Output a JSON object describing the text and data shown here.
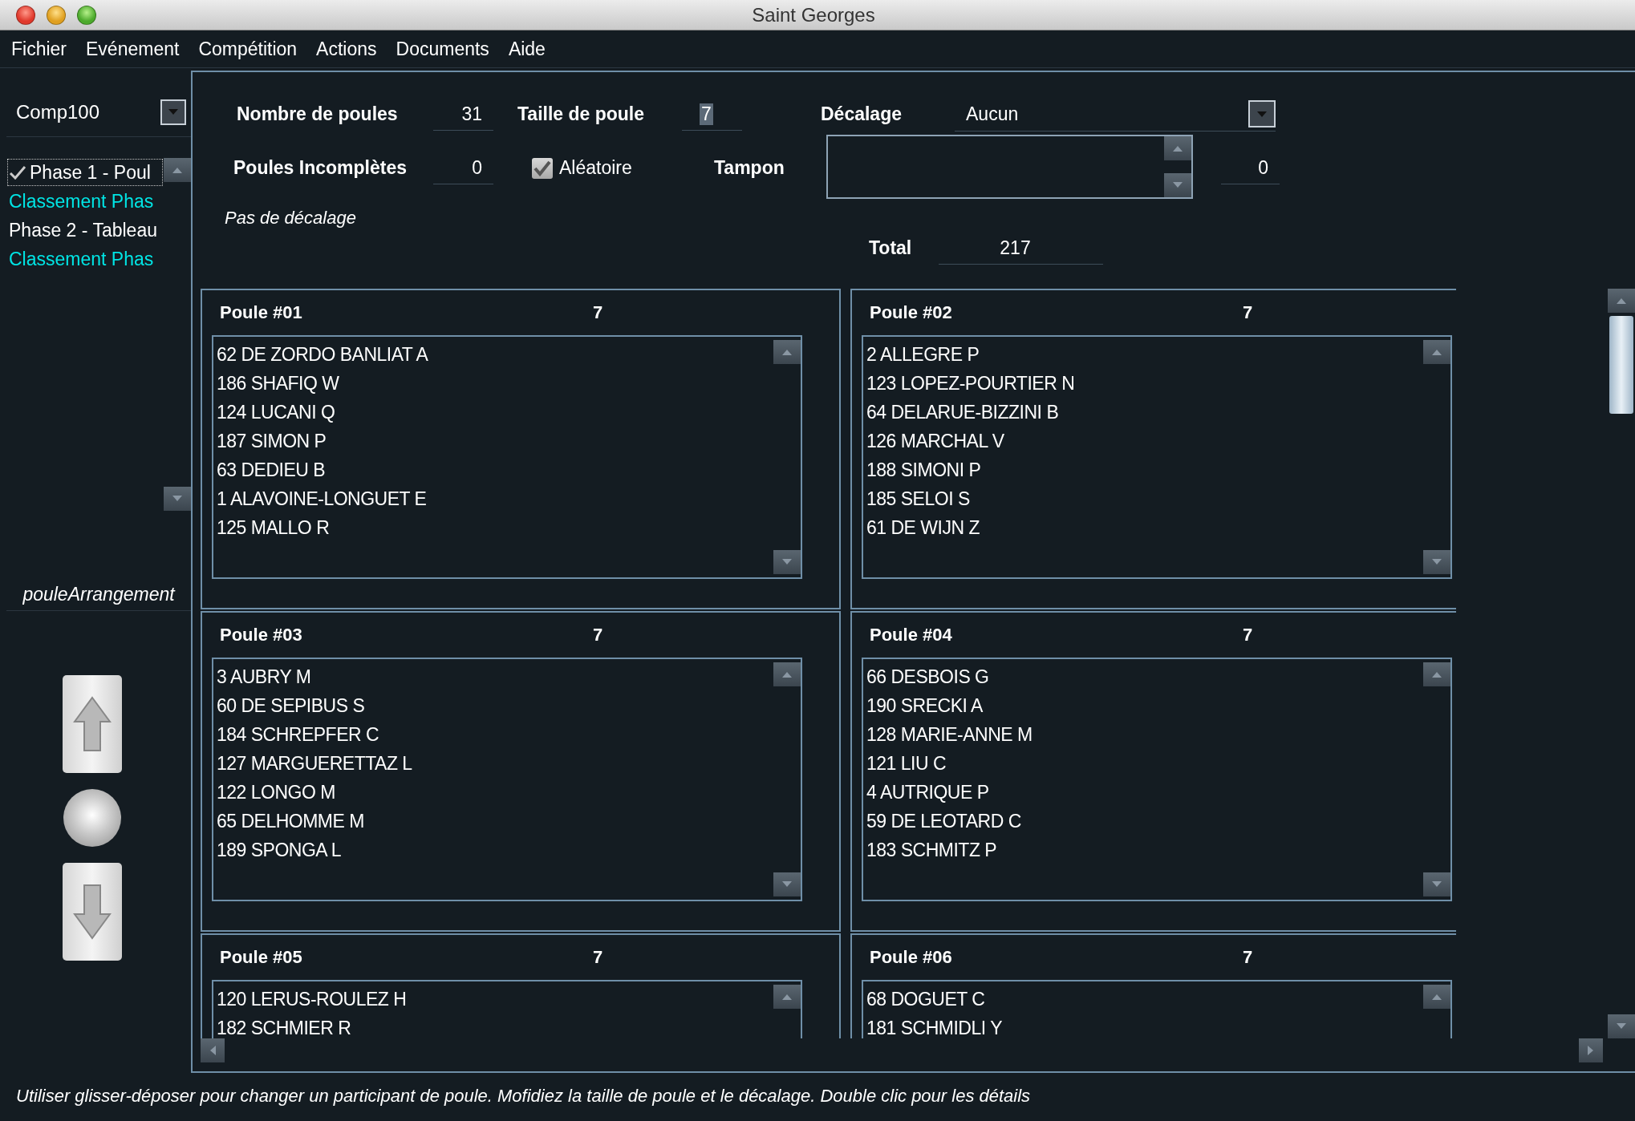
{
  "window": {
    "title": "Saint Georges"
  },
  "menu": [
    "Fichier",
    "Evénement",
    "Compétition",
    "Actions",
    "Documents",
    "Aide"
  ],
  "sidebar": {
    "competition": "Comp100",
    "phases": [
      {
        "label": "Phase 1 - Poul",
        "checked": true,
        "selected": true,
        "color": "#ffffff"
      },
      {
        "label": "Classement Phas",
        "checked": false,
        "selected": false,
        "color": "#00e5e5"
      },
      {
        "label": "Phase 2 - Tableau",
        "checked": false,
        "selected": false,
        "color": "#ffffff"
      },
      {
        "label": "Classement Phas",
        "checked": false,
        "selected": false,
        "color": "#00e5e5"
      }
    ],
    "section_label": "pouleArrangement"
  },
  "form": {
    "nombre_de_poules": {
      "label": "Nombre de poules",
      "value": "31"
    },
    "taille_de_poule": {
      "label": "Taille de poule",
      "value": "7"
    },
    "decalage": {
      "label": "Décalage",
      "value": "Aucun"
    },
    "poules_incompletes": {
      "label": "Poules Incomplètes",
      "value": "0"
    },
    "aleatoire": {
      "label": "Aléatoire",
      "checked": true
    },
    "tampon": {
      "label": "Tampon",
      "value": "0"
    },
    "note": "Pas de décalage",
    "total": {
      "label": "Total",
      "value": "217"
    }
  },
  "poules": [
    {
      "name": "Poule #01",
      "count": "7",
      "fencers": [
        "62 DE ZORDO BANLIAT A",
        "186 SHAFIQ W",
        "124 LUCANI Q",
        "187 SIMON P",
        "63 DEDIEU B",
        "1 ALAVOINE-LONGUET E",
        "125 MALLO R"
      ]
    },
    {
      "name": "Poule #02",
      "count": "7",
      "fencers": [
        "2 ALLEGRE P",
        "123 LOPEZ-POURTIER N",
        "64 DELARUE-BIZZINI B",
        "126 MARCHAL V",
        "188 SIMONI P",
        "185 SELOI S",
        "61 DE WIJN Z"
      ]
    },
    {
      "name": "Poule #03",
      "count": "7",
      "fencers": [
        "3 AUBRY M",
        "60 DE SEPIBUS S",
        "184 SCHREPFER C",
        "127 MARGUERETTAZ L",
        "122 LONGO M",
        "65 DELHOMME M",
        "189 SPONGA L"
      ]
    },
    {
      "name": "Poule #04",
      "count": "7",
      "fencers": [
        "66 DESBOIS G",
        "190 SRECKI A",
        "128 MARIE-ANNE M",
        "121 LIU C",
        "4 AUTRIQUE P",
        "59 DE LEOTARD C",
        "183 SCHMITZ P"
      ]
    },
    {
      "name": "Poule #05",
      "count": "7",
      "fencers": [
        "120 LERUS-ROULEZ H",
        "182 SCHMIER R"
      ]
    },
    {
      "name": "Poule #06",
      "count": "7",
      "fencers": [
        "68 DOGUET C",
        "181 SCHMIDLI Y"
      ]
    }
  ],
  "status_bar": "Utiliser glisser-déposer pour changer un participant de poule. Mofidiez la taille de poule et le décalage. Double clic pour les détails"
}
